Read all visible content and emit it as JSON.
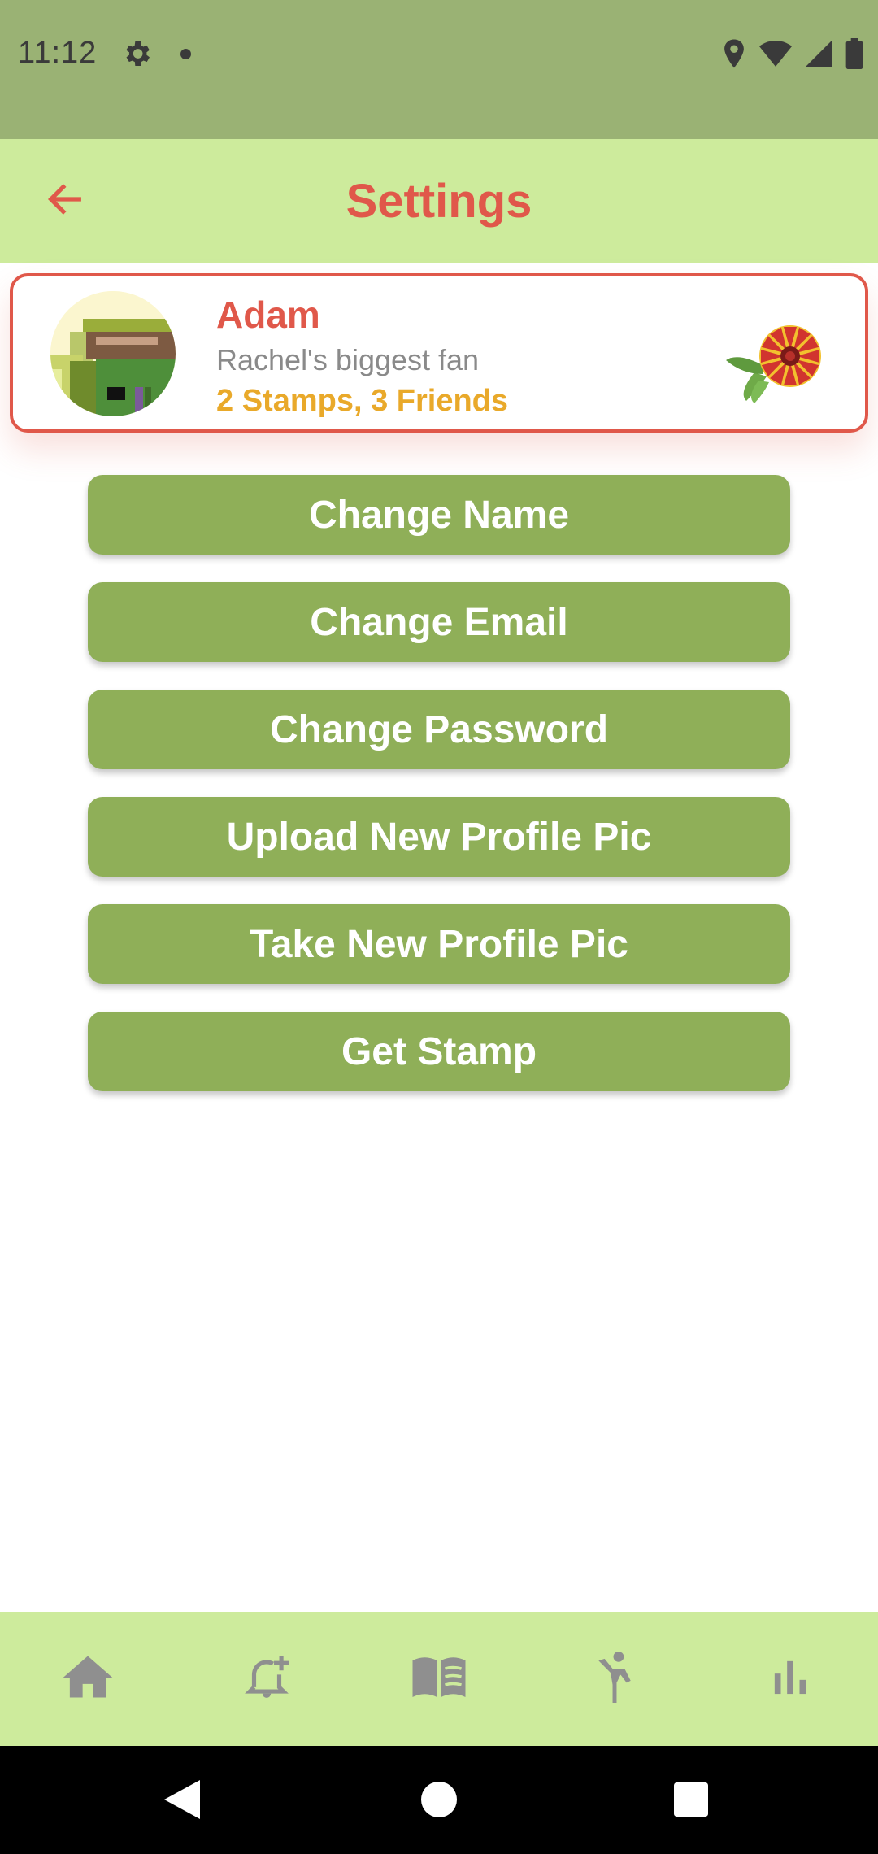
{
  "status_bar": {
    "time": "11:12",
    "icons": [
      "settings-icon",
      "notification-dot",
      "location-icon",
      "wifi-icon",
      "signal-icon",
      "battery-icon"
    ]
  },
  "app_bar": {
    "title": "Settings",
    "back_icon": "arrow-back-icon"
  },
  "profile": {
    "name": "Adam",
    "bio": "Rachel's biggest fan",
    "stats": "2 Stamps, 3 Friends",
    "avatar": "pixel-art-avatar",
    "stamp": "red-yellow-flower"
  },
  "menu": {
    "change_name": "Change Name",
    "change_email": "Change Email",
    "change_password": "Change Password",
    "upload_pic": "Upload New Profile Pic",
    "take_pic": "Take New Profile Pic",
    "get_stamp": "Get Stamp"
  },
  "bottom_nav": {
    "items": [
      "home-icon",
      "add-alert-icon",
      "book-icon",
      "person-activity-icon",
      "bar-chart-icon"
    ]
  },
  "system_nav": {
    "items": [
      "back-triangle-icon",
      "home-circle-icon",
      "recents-square-icon"
    ]
  },
  "colors": {
    "status_bar": "#9ab274",
    "app_bar": "#cdeb9c",
    "accent": "#e0584a",
    "stats": "#e9a92a",
    "button": "#8faf58"
  }
}
